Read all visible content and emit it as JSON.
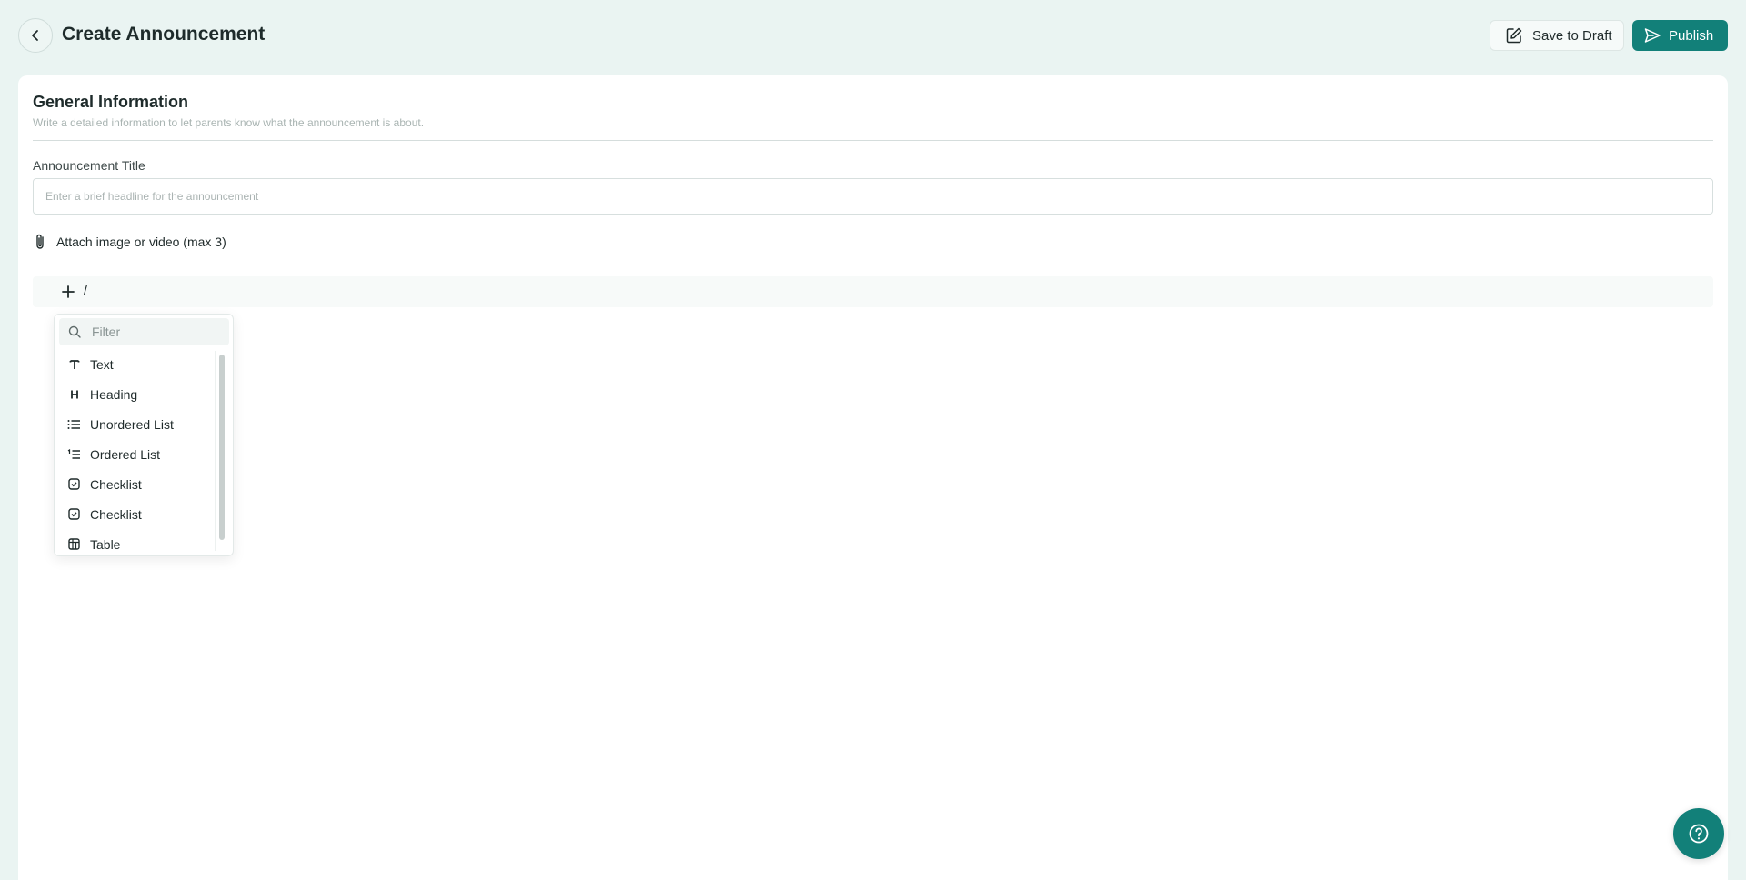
{
  "header": {
    "title": "Create Announcement",
    "draft_label": "Save to Draft",
    "publish_label": "Publish"
  },
  "general": {
    "title": "General Information",
    "subtitle": "Write a detailed information to let parents know what the announcement is about.",
    "field_label": "Announcement Title",
    "field_placeholder": "Enter a brief headline for the announcement",
    "field_value": "",
    "attach_label": "Attach image or video (max 3)"
  },
  "editor": {
    "slash": "/"
  },
  "menu": {
    "filter_placeholder": "Filter",
    "items": [
      {
        "label": "Text",
        "icon": "text-icon"
      },
      {
        "label": "Heading",
        "icon": "heading-icon"
      },
      {
        "label": "Unordered List",
        "icon": "unordered-list-icon"
      },
      {
        "label": "Ordered List",
        "icon": "ordered-list-icon"
      },
      {
        "label": "Checklist",
        "icon": "checklist-icon"
      },
      {
        "label": "Checklist",
        "icon": "checklist-icon"
      },
      {
        "label": "Table",
        "icon": "table-icon"
      }
    ]
  },
  "colors": {
    "accent": "#128079",
    "background": "#eaf4f2"
  }
}
